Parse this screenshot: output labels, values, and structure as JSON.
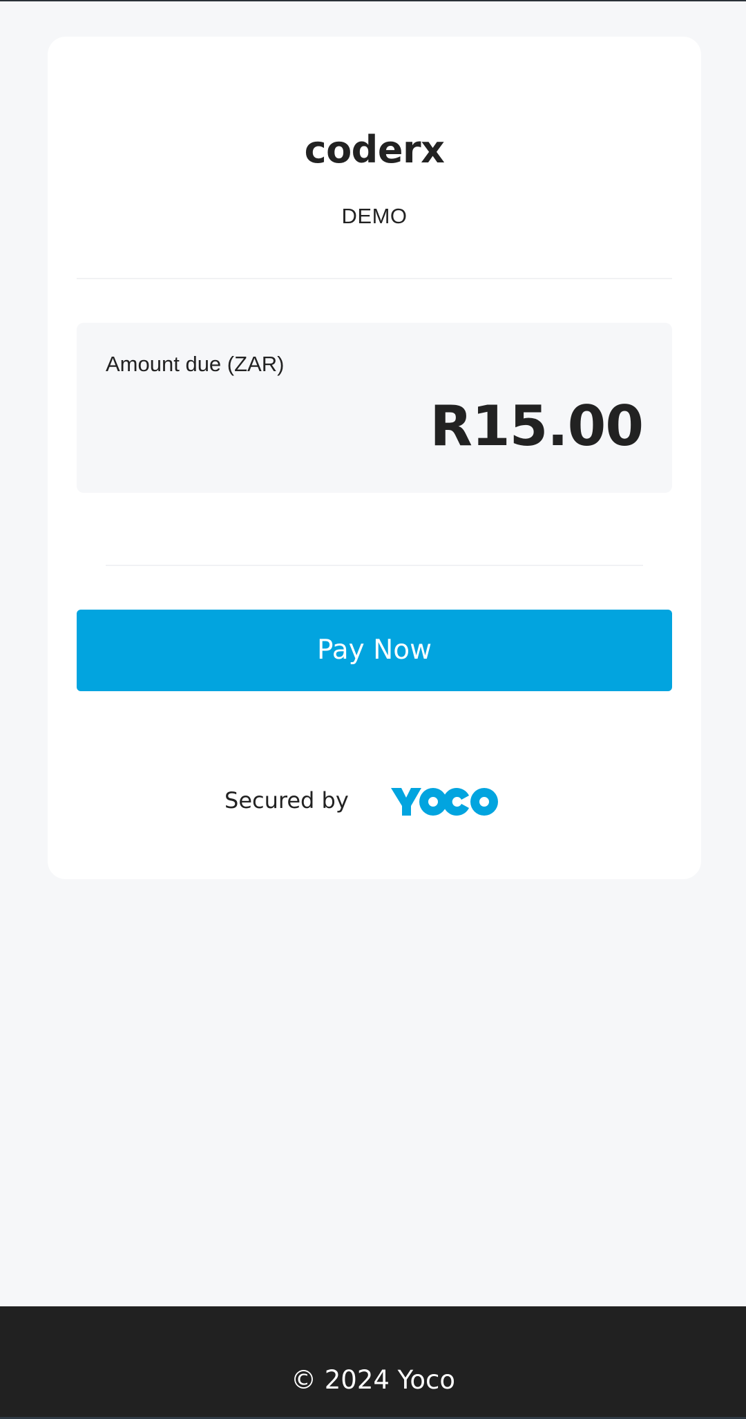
{
  "merchant": {
    "name": "coderx",
    "tag": "DEMO"
  },
  "amount": {
    "label": "Amount due (ZAR)",
    "value": "R15.00"
  },
  "actions": {
    "pay_label": "Pay Now"
  },
  "security": {
    "secured_by_label": "Secured by",
    "logo_text": "YOCO",
    "logo_icon": "yoco-logo"
  },
  "footer": {
    "copyright": "© 2024 Yoco"
  },
  "colors": {
    "accent": "#02a4df",
    "page_background": "#f6f7f9",
    "card_background": "#ffffff",
    "text": "#222222",
    "footer_background": "#212121"
  }
}
